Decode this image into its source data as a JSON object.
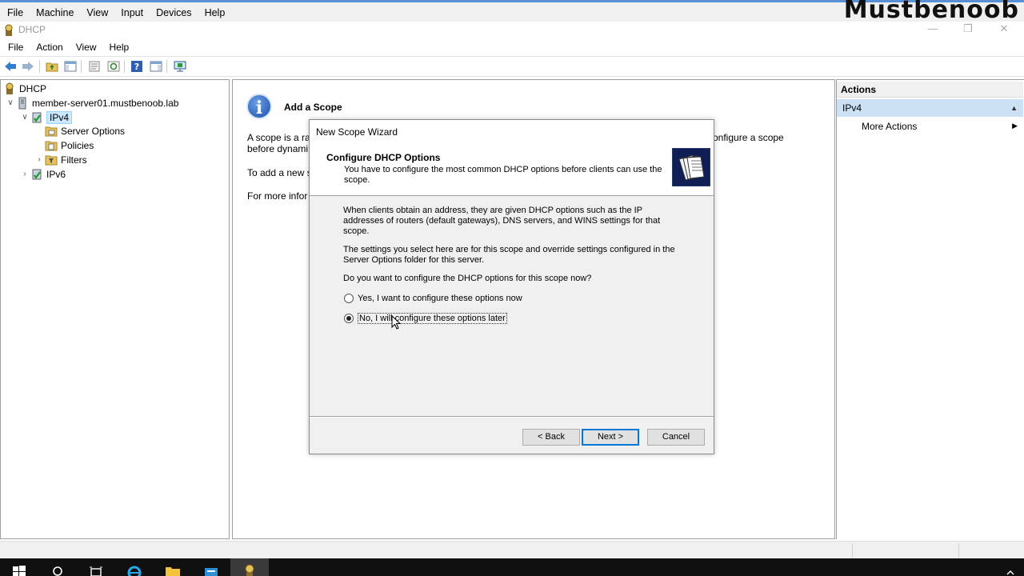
{
  "vbox": {
    "menu": [
      "File",
      "Machine",
      "View",
      "Input",
      "Devices",
      "Help"
    ],
    "watermark": "Mustbenoob"
  },
  "window": {
    "title": "DHCP",
    "menu": [
      "File",
      "Action",
      "View",
      "Help"
    ]
  },
  "tree": {
    "root": "DHCP",
    "server": "member-server01.mustbenoob.lab",
    "ipv4": "IPv4",
    "children": [
      "Server Options",
      "Policies",
      "Filters"
    ],
    "ipv6": "IPv6"
  },
  "main": {
    "title": "Add a Scope",
    "line1_left": "A scope is a ran",
    "line1_right": "onfigure a scope",
    "line2": "before dynami",
    "line3": "To add a new s",
    "line4": "For more infor"
  },
  "actions": {
    "header": "Actions",
    "section": "IPv4",
    "more": "More Actions"
  },
  "wizard": {
    "title": "New Scope Wizard",
    "heading": "Configure DHCP Options",
    "subheading": "You have to configure the most common DHCP options before clients can use the scope.",
    "para1": "When clients obtain an address, they are given DHCP options such as the IP addresses of routers (default gateways), DNS servers, and WINS settings for that scope.",
    "para2": "The settings you select here are for this scope and override settings configured in the Server Options folder for this server.",
    "question": "Do you want to configure the DHCP options for this scope now?",
    "option_yes": "Yes, I want to configure these options now",
    "option_no": "No, I will configure these options later",
    "selected": "no",
    "back": "< Back",
    "next": "Next >",
    "cancel": "Cancel"
  },
  "colors": {
    "selection": "#cce8ff",
    "accent": "#0078d7",
    "taskbar": "#101010"
  }
}
